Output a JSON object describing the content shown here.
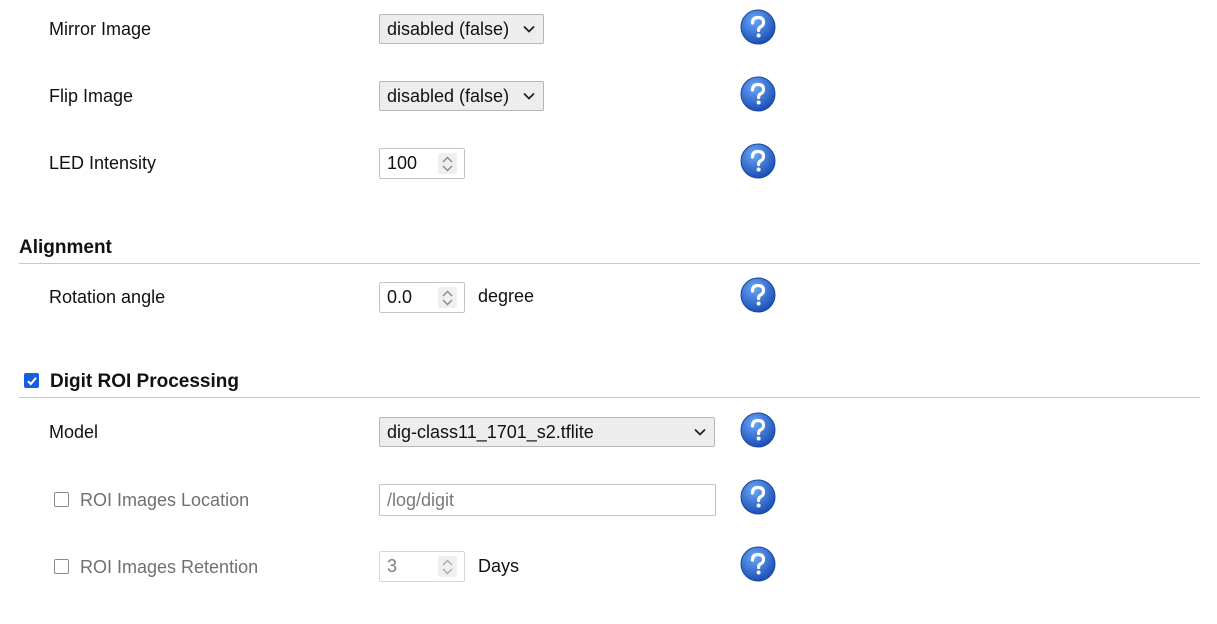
{
  "camera": {
    "mirror": {
      "label": "Mirror Image",
      "value": "disabled (false)"
    },
    "flip": {
      "label": "Flip Image",
      "value": "disabled (false)"
    },
    "led": {
      "label": "LED Intensity",
      "value": "100"
    }
  },
  "alignment": {
    "title": "Alignment",
    "rotation": {
      "label": "Rotation angle",
      "value": "0.0",
      "unit": "degree"
    }
  },
  "digits": {
    "title": "Digit ROI Processing",
    "enabled": true,
    "model": {
      "label": "Model",
      "value": "dig-class11_1701_s2.tflite"
    },
    "roi_location": {
      "label": "ROI Images Location",
      "enabled": false,
      "value": "/log/digit"
    },
    "roi_retention": {
      "label": "ROI Images Retention",
      "enabled": false,
      "value": "3",
      "unit": "Days"
    }
  },
  "icons": {
    "help": "help-question-icon",
    "chevron": "chevron-down-icon",
    "spinner": "spinner-arrows-icon",
    "check": "checkmark-icon"
  },
  "colors": {
    "help_blue": "#2b6fd6",
    "checkbox_blue": "#1a5ee0",
    "divider": "#c8c8c8"
  }
}
